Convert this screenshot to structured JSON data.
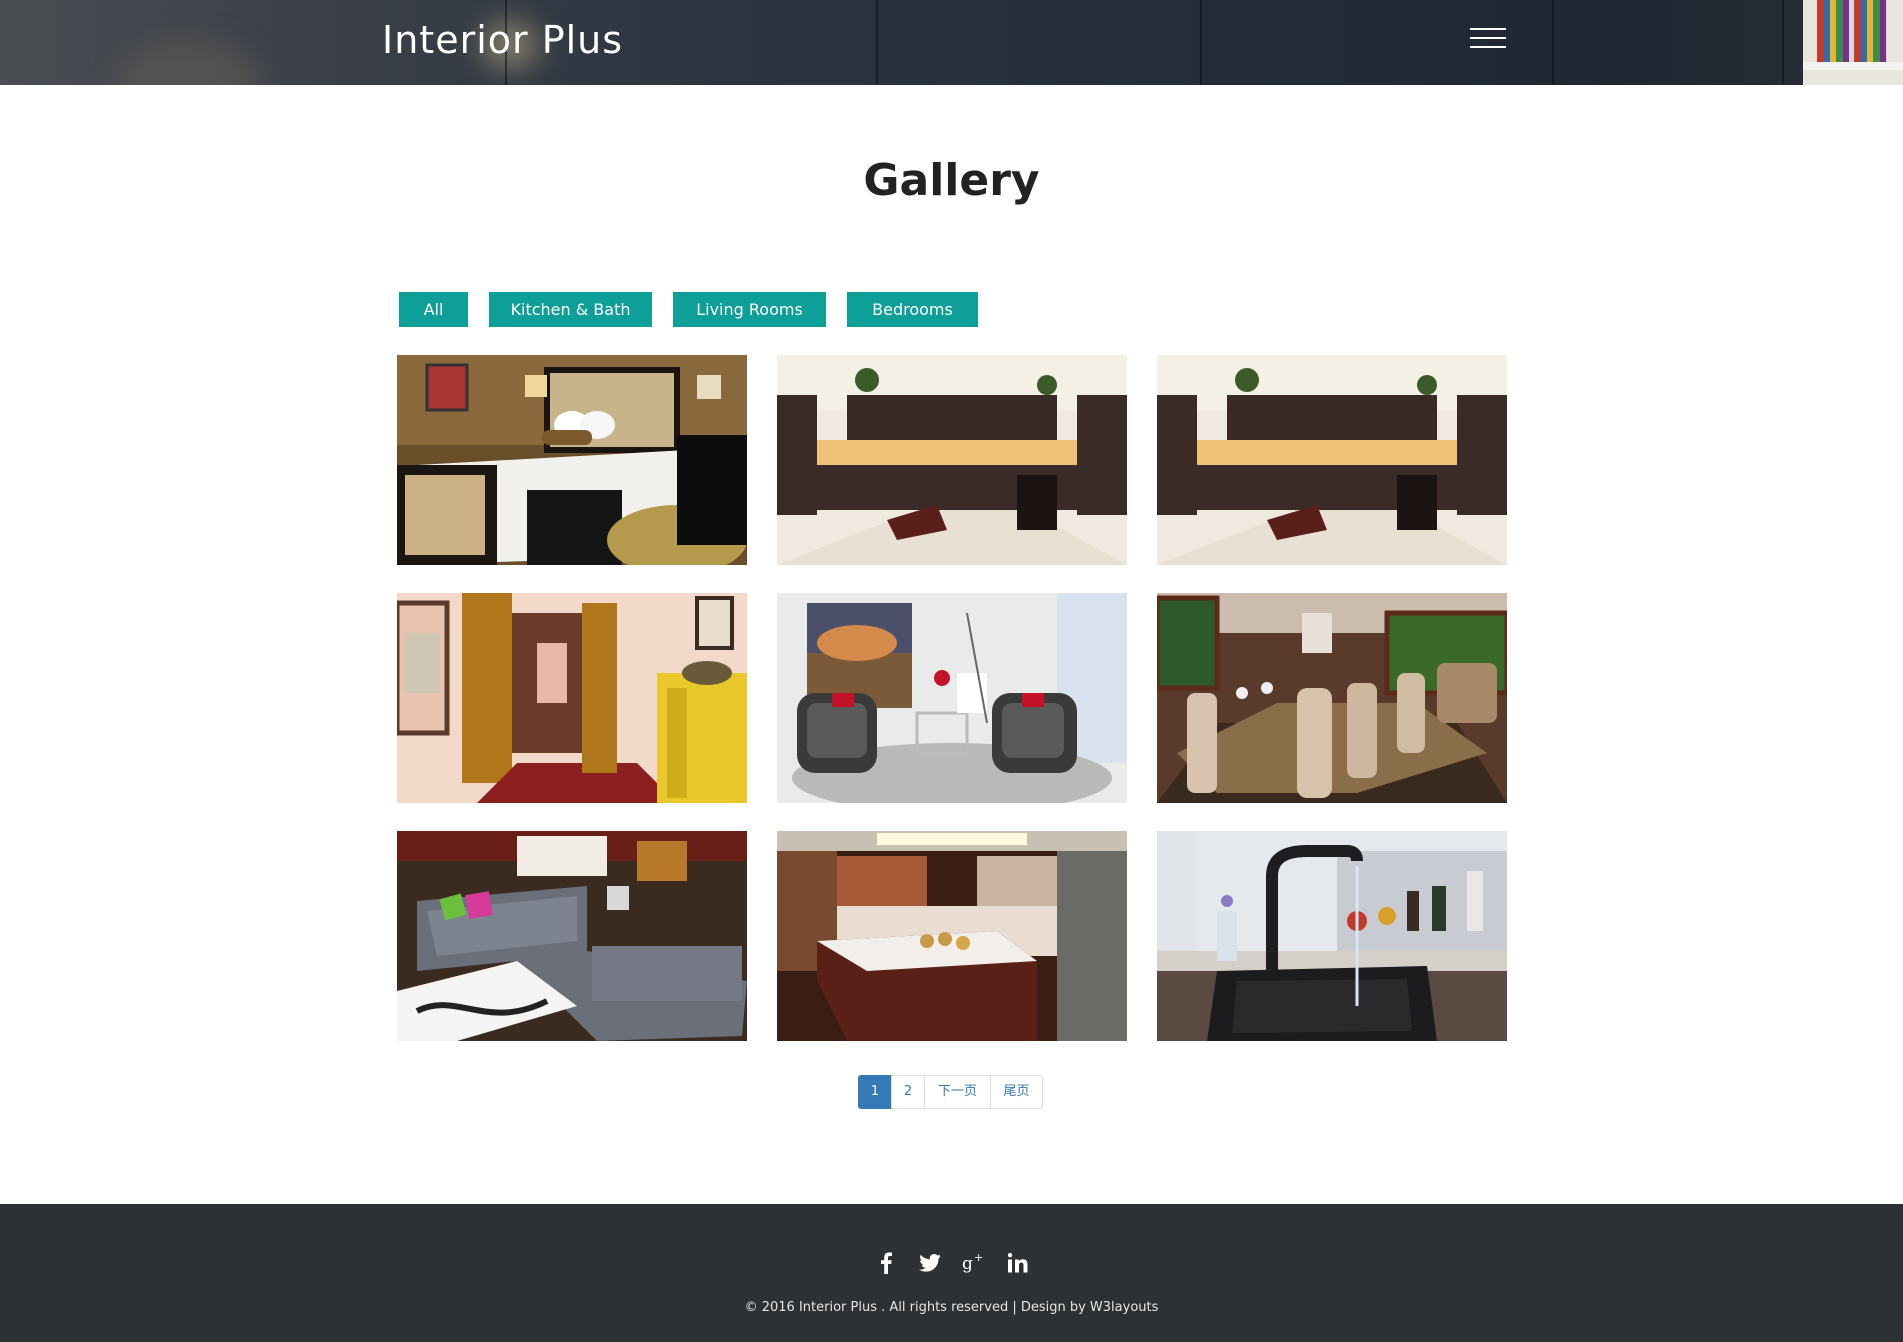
{
  "site": {
    "logo": "Interior Plus"
  },
  "page": {
    "title": "Gallery"
  },
  "filters": [
    "All",
    "Kitchen & Bath",
    "Living Rooms",
    "Bedrooms"
  ],
  "pagination": {
    "pages": [
      "1",
      "2"
    ],
    "next": "下一页",
    "last": "尾页",
    "current": "1"
  },
  "footer": {
    "social": [
      "facebook-icon",
      "twitter-icon",
      "google-plus-icon",
      "linkedin-icon"
    ],
    "copyright": "© 2016 Interior Plus . All rights reserved | Design by W3layouts"
  },
  "colors": {
    "accent": "#0f9f99",
    "footer_bg": "#2e3134",
    "pagination_active": "#337ab7"
  }
}
